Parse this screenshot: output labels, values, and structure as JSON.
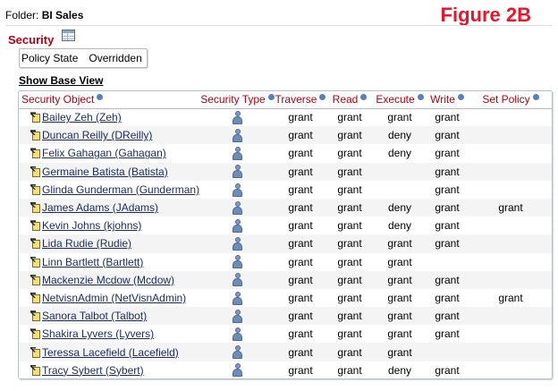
{
  "folder": {
    "label": "Folder:",
    "name": "BI Sales"
  },
  "figure_label": "Figure 2B",
  "section_title": "Security",
  "policy": {
    "label": "Policy State",
    "value": "Overridden"
  },
  "show_base_view": "Show Base View",
  "columns": [
    "Security Object",
    "Security Type",
    "Traverse",
    "Read",
    "Execute",
    "Write",
    "Set Policy"
  ],
  "rows": [
    {
      "name": "Bailey Zeh (Zeh)",
      "traverse": "grant",
      "read": "grant",
      "execute": "grant",
      "write": "grant",
      "set_policy": ""
    },
    {
      "name": "Duncan Reilly (DReilly)",
      "traverse": "grant",
      "read": "grant",
      "execute": "deny",
      "write": "grant",
      "set_policy": ""
    },
    {
      "name": "Felix Gahagan (Gahagan)",
      "traverse": "grant",
      "read": "grant",
      "execute": "deny",
      "write": "grant",
      "set_policy": ""
    },
    {
      "name": "Germaine Batista (Batista)",
      "traverse": "grant",
      "read": "grant",
      "execute": "",
      "write": "grant",
      "set_policy": ""
    },
    {
      "name": "Glinda Gunderman (Gunderman)",
      "traverse": "grant",
      "read": "grant",
      "execute": "",
      "write": "grant",
      "set_policy": ""
    },
    {
      "name": "James Adams (JAdams)",
      "traverse": "grant",
      "read": "grant",
      "execute": "deny",
      "write": "grant",
      "set_policy": "grant"
    },
    {
      "name": "Kevin Johns (kjohns)",
      "traverse": "grant",
      "read": "grant",
      "execute": "deny",
      "write": "grant",
      "set_policy": ""
    },
    {
      "name": "Lida Rudie (Rudie)",
      "traverse": "grant",
      "read": "grant",
      "execute": "grant",
      "write": "grant",
      "set_policy": ""
    },
    {
      "name": "Linn Bartlett (Bartlett)",
      "traverse": "grant",
      "read": "grant",
      "execute": "grant",
      "write": "",
      "set_policy": ""
    },
    {
      "name": "Mackenzie Mcdow (Mcdow)",
      "traverse": "grant",
      "read": "grant",
      "execute": "grant",
      "write": "grant",
      "set_policy": ""
    },
    {
      "name": "NetvisnAdmin (NetVisnAdmin)",
      "traverse": "grant",
      "read": "grant",
      "execute": "grant",
      "write": "grant",
      "set_policy": "grant"
    },
    {
      "name": "Sanora Talbot (Talbot)",
      "traverse": "grant",
      "read": "grant",
      "execute": "grant",
      "write": "grant",
      "set_policy": ""
    },
    {
      "name": "Shakira Lyvers (Lyvers)",
      "traverse": "grant",
      "read": "grant",
      "execute": "grant",
      "write": "grant",
      "set_policy": ""
    },
    {
      "name": "Teressa Lacefield (Lacefield)",
      "traverse": "grant",
      "read": "grant",
      "execute": "grant",
      "write": "",
      "set_policy": ""
    },
    {
      "name": "Tracy Sybert (Sybert)",
      "traverse": "grant",
      "read": "grant",
      "execute": "deny",
      "write": "grant",
      "set_policy": ""
    }
  ],
  "colors": {
    "accent_red": "#b00012",
    "figure_red": "#e8152b",
    "link": "#1a2a5e"
  },
  "icons": {
    "object": "user-object-icon",
    "security_type": "user-icon",
    "info": "info-icon",
    "table": "table-view-icon"
  }
}
